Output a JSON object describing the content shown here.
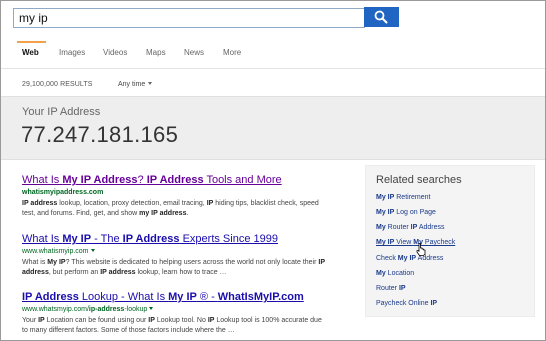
{
  "search": {
    "query": "my ip",
    "placeholder": "",
    "button_icon": "search-icon"
  },
  "scopes": [
    {
      "label": "Web",
      "active": true
    },
    {
      "label": "Images",
      "active": false
    },
    {
      "label": "Videos",
      "active": false
    },
    {
      "label": "Maps",
      "active": false
    },
    {
      "label": "News",
      "active": false
    },
    {
      "label": "More",
      "active": false
    }
  ],
  "results_count": "29,100,000 RESULTS",
  "time_filter": {
    "label": "Any time",
    "icon": "chevron-down-icon"
  },
  "answer": {
    "label": "Your IP Address",
    "value": "77.247.181.165"
  },
  "results": [
    {
      "title": [
        {
          "t": "What Is ",
          "b": false
        },
        {
          "t": "My IP Address",
          "b": true
        },
        {
          "t": "? ",
          "b": false
        },
        {
          "t": "IP Address",
          "b": true
        },
        {
          "t": " Tools and More",
          "b": false
        }
      ],
      "visited": true,
      "url": [
        {
          "t": "whatismyipaddress.com",
          "b": true
        }
      ],
      "url_caret": false,
      "snippet": [
        {
          "t": "IP address",
          "b": true
        },
        {
          "t": " lookup, location, proxy detection, email tracing, ",
          "b": false
        },
        {
          "t": "IP",
          "b": true
        },
        {
          "t": " hiding tips, blacklist check, speed test, and forums. Find, get, and show ",
          "b": false
        },
        {
          "t": "my IP address",
          "b": true
        },
        {
          "t": ".",
          "b": false
        }
      ]
    },
    {
      "title": [
        {
          "t": "What Is ",
          "b": false
        },
        {
          "t": "My IP",
          "b": true
        },
        {
          "t": " - The ",
          "b": false
        },
        {
          "t": "IP Address",
          "b": true
        },
        {
          "t": " Experts Since 1999",
          "b": false
        }
      ],
      "visited": false,
      "url": [
        {
          "t": "www.whatismyip.com",
          "b": false
        }
      ],
      "url_caret": true,
      "snippet": [
        {
          "t": "What is ",
          "b": false
        },
        {
          "t": "My IP",
          "b": true
        },
        {
          "t": "? This website is dedicated to helping users across the world not only locate their ",
          "b": false
        },
        {
          "t": "IP address",
          "b": true
        },
        {
          "t": ", but perform an ",
          "b": false
        },
        {
          "t": "IP address",
          "b": true
        },
        {
          "t": " lookup, learn how to trace …",
          "b": false
        }
      ]
    },
    {
      "title": [
        {
          "t": "IP Address",
          "b": true
        },
        {
          "t": " Lookup - What Is ",
          "b": false
        },
        {
          "t": "My IP",
          "b": true
        },
        {
          "t": " ® - ",
          "b": false
        },
        {
          "t": "WhatIsMyIP.com",
          "b": true
        }
      ],
      "visited": false,
      "url": [
        {
          "t": "www.whatsmyip.com/",
          "b": false
        },
        {
          "t": "ip-address",
          "b": true
        },
        {
          "t": "-lookup",
          "b": false
        }
      ],
      "url_caret": true,
      "snippet": [
        {
          "t": "Your ",
          "b": false
        },
        {
          "t": "IP",
          "b": true
        },
        {
          "t": " Location can be found using our ",
          "b": false
        },
        {
          "t": "IP",
          "b": true
        },
        {
          "t": " Lookup tool. No ",
          "b": false
        },
        {
          "t": "IP",
          "b": true
        },
        {
          "t": " Lookup tool is 100% accurate due to many different factors. Some of those factors include where the …",
          "b": false
        }
      ]
    }
  ],
  "related": {
    "heading": "Related searches",
    "items": [
      [
        {
          "t": "My IP",
          "b": true
        },
        {
          "t": " Retirement",
          "b": false
        }
      ],
      [
        {
          "t": "My IP",
          "b": true
        },
        {
          "t": " Log on Page",
          "b": false
        }
      ],
      [
        {
          "t": "My",
          "b": true
        },
        {
          "t": " Router ",
          "b": false
        },
        {
          "t": "IP",
          "b": true
        },
        {
          "t": " Address",
          "b": false
        }
      ],
      [
        {
          "t": "My IP",
          "b": true
        },
        {
          "t": " View ",
          "b": false
        },
        {
          "t": "My",
          "b": true
        },
        {
          "t": " Paycheck",
          "b": false
        }
      ],
      [
        {
          "t": "Check ",
          "b": false
        },
        {
          "t": "My IP",
          "b": true
        },
        {
          "t": " Address",
          "b": false
        }
      ],
      [
        {
          "t": "My",
          "b": true
        },
        {
          "t": " Location",
          "b": false
        }
      ],
      [
        {
          "t": "Router ",
          "b": false
        },
        {
          "t": "IP",
          "b": true
        }
      ],
      [
        {
          "t": "Paycheck Online ",
          "b": false
        },
        {
          "t": "IP",
          "b": true
        }
      ]
    ],
    "hover_index": 3
  },
  "colors": {
    "accent": "#2165c2",
    "link": "#1a0dab",
    "visited": "#660099",
    "url": "#006621",
    "scope_underline": "#f0a14a"
  }
}
